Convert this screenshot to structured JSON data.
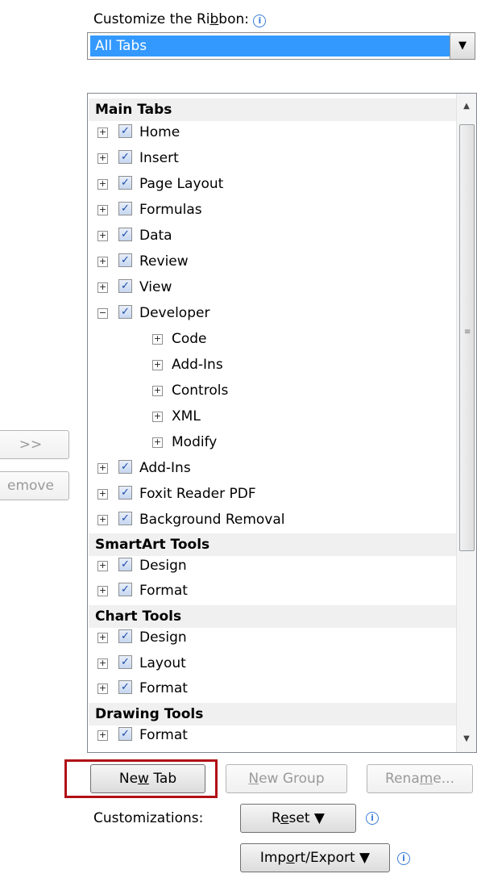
{
  "header": {
    "label_pre": "Customize the Ri",
    "label_ul": "b",
    "label_post": "bon:",
    "dropdown_value": "All Tabs"
  },
  "left_buttons": {
    "add": ">>",
    "remove": "emove"
  },
  "tree": {
    "sections": [
      {
        "title": "Main Tabs"
      },
      {
        "title": "SmartArt Tools"
      },
      {
        "title": "Chart Tools"
      },
      {
        "title": "Drawing Tools"
      }
    ],
    "items": [
      {
        "label": "Home",
        "checked": true
      },
      {
        "label": "Insert",
        "checked": true
      },
      {
        "label": "Page Layout",
        "checked": true
      },
      {
        "label": "Formulas",
        "checked": true
      },
      {
        "label": "Data",
        "checked": true
      },
      {
        "label": "Review",
        "checked": true
      },
      {
        "label": "View",
        "checked": true
      },
      {
        "label": "Developer",
        "checked": true,
        "expanded": true
      },
      {
        "label": "Code"
      },
      {
        "label": "Add-Ins"
      },
      {
        "label": "Controls"
      },
      {
        "label": "XML"
      },
      {
        "label": "Modify"
      },
      {
        "label": "Add-Ins",
        "checked": true
      },
      {
        "label": "Foxit Reader PDF",
        "checked": true
      },
      {
        "label": "Background Removal",
        "checked": true
      },
      {
        "label": "Design",
        "checked": true
      },
      {
        "label": "Format",
        "checked": true
      },
      {
        "label": "Design",
        "checked": true
      },
      {
        "label": "Layout",
        "checked": true
      },
      {
        "label": "Format",
        "checked": true
      },
      {
        "label": "Format",
        "checked": true
      }
    ]
  },
  "buttons": {
    "new_tab_pre": "Ne",
    "new_tab_ul": "w",
    "new_tab_post": " Tab",
    "new_group_ul": "N",
    "new_group_post": "ew Group",
    "rename_pre": "Rena",
    "rename_ul": "m",
    "rename_post": "e...",
    "reset_pre": "R",
    "reset_ul": "e",
    "reset_post": "set ▼",
    "import_pre": "Imp",
    "import_ul": "o",
    "import_post": "rt/Export ▼"
  },
  "customizations_label": "Customizations:",
  "highlight_color": "#b11116",
  "selection_color": "#3399ff"
}
